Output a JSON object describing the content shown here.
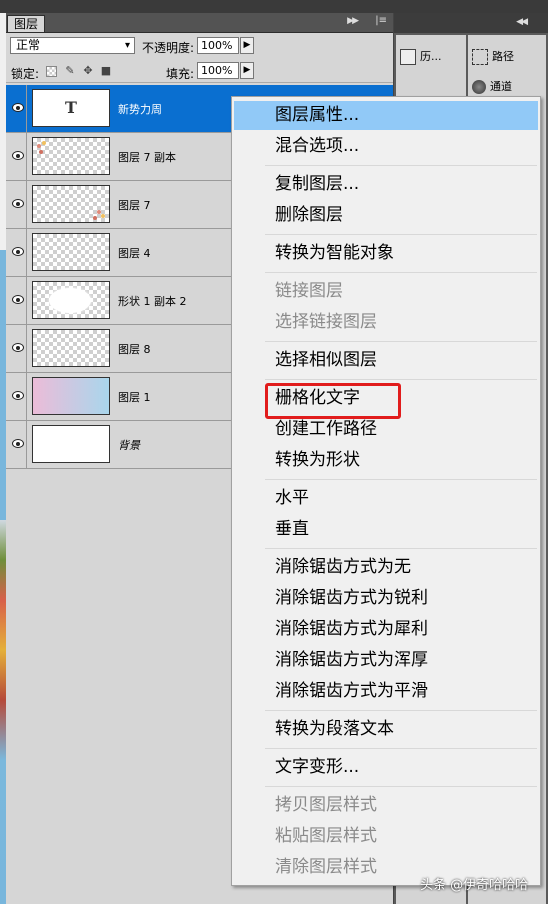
{
  "layers_panel": {
    "tab": "图层",
    "blend_mode": "正常",
    "opacity_label": "不透明度:",
    "opacity_value": "100%",
    "lock_label": "锁定:",
    "fill_label": "填充:",
    "fill_value": "100%",
    "layers": [
      {
        "name": "新势力周",
        "thumb": "T"
      },
      {
        "name": "图层 7 副本"
      },
      {
        "name": "图层 7"
      },
      {
        "name": "图层 4"
      },
      {
        "name": "形状 1 副本 2"
      },
      {
        "name": "图层 8"
      },
      {
        "name": "图层 1"
      },
      {
        "name": "背景"
      }
    ]
  },
  "right_dock": {
    "history": "历...",
    "paths": "路径",
    "channels": "通道"
  },
  "context_menu": {
    "items": [
      "图层属性...",
      "混合选项...",
      "复制图层...",
      "删除图层",
      "转换为智能对象",
      "链接图层",
      "选择链接图层",
      "选择相似图层",
      "栅格化文字",
      "创建工作路径",
      "转换为形状",
      "水平",
      "垂直",
      "消除锯齿方式为无",
      "消除锯齿方式为锐利",
      "消除锯齿方式为犀利",
      "消除锯齿方式为浑厚",
      "消除锯齿方式为平滑",
      "转换为段落文本",
      "文字变形...",
      "拷贝图层样式",
      "粘贴图层样式",
      "清除图层样式"
    ]
  },
  "watermark": "头条 @伊奇哈哈哈",
  "colors": {
    "selection_blue": "#0a6fd0",
    "menu_highlight": "#91c9f7",
    "callout_red": "#e11c1c"
  }
}
